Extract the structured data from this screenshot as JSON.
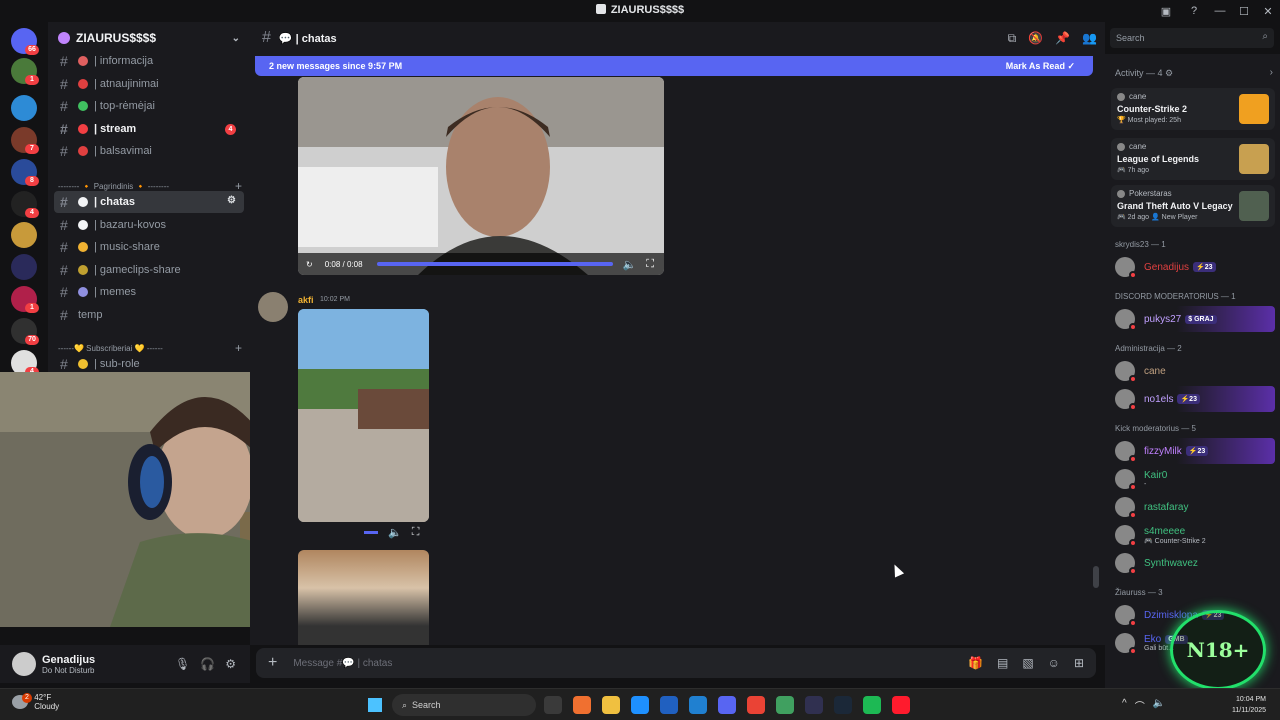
{
  "window": {
    "title": "ZIAURUS$$$$"
  },
  "servers": [
    {
      "color": "#5865f2",
      "badge": "66"
    },
    {
      "color": "#4a7a3a",
      "badge": "1"
    },
    {
      "color": "#2d8bd6",
      "badge": ""
    },
    {
      "color": "#7a3a2a",
      "badge": "7"
    },
    {
      "color": "#2a4b9a",
      "badge": "8"
    },
    {
      "color": "#222222",
      "badge": "4"
    },
    {
      "color": "#c89a3a",
      "badge": ""
    },
    {
      "color": "#2a2a5a",
      "badge": ""
    },
    {
      "color": "#b0204a",
      "badge": "1"
    },
    {
      "color": "#303030",
      "badge": "70"
    },
    {
      "color": "#e0e0e0",
      "badge": "4"
    }
  ],
  "guild": {
    "name": "ZIAURUS$$$$"
  },
  "channels": [
    {
      "label": "| informacija",
      "emoji_color": "#e06060",
      "state": "normal"
    },
    {
      "label": "| atnaujinimai",
      "emoji_color": "#e04040",
      "state": "normal"
    },
    {
      "label": "| top-rėmėjai",
      "emoji_color": "#40c060",
      "state": "normal"
    },
    {
      "label": "| stream",
      "emoji_color": "#f23f43",
      "state": "unread",
      "badge": "4"
    },
    {
      "label": "| balsavimai",
      "emoji_color": "#e04040",
      "state": "normal"
    }
  ],
  "category1": "-------- 🔸 Pagrindinis 🔸 --------",
  "channels2": [
    {
      "label": "| chatas",
      "emoji_color": "#f2f3f5",
      "state": "active"
    },
    {
      "label": "| bazaru-kovos",
      "emoji_color": "#f2f3f5",
      "state": "normal"
    },
    {
      "label": "| music-share",
      "emoji_color": "#f0b232",
      "state": "normal"
    },
    {
      "label": "| gameclips-share",
      "emoji_color": "#c0a030",
      "state": "normal"
    },
    {
      "label": "| memes",
      "emoji_color": "#9090e0",
      "state": "normal"
    },
    {
      "label": "temp",
      "emoji_color": "",
      "state": "normal"
    }
  ],
  "category2": "------💛 Subscriberiai 💛 ------",
  "channels3": [
    {
      "label": "| sub-role",
      "emoji_color": "#f0c030",
      "state": "normal"
    }
  ],
  "user": {
    "name": "Genadijus",
    "status": "Do Not Disturb"
  },
  "chat": {
    "channel_name": "| chatas",
    "new_messages": "2 new messages since 9:57 PM",
    "mark_read": "Mark As Read",
    "video_time": "0:08 / 0:08",
    "video_progress": 1.0,
    "author": "akfi",
    "time": "10:02 PM",
    "placeholder": "Message #💬 | chatas"
  },
  "search": {
    "placeholder": "Search"
  },
  "activity": {
    "header": "Activity — 4 ⚙",
    "cards": [
      {
        "user": "cane",
        "game": "Counter-Strike 2",
        "meta": "🏆 Most played: 25h",
        "color": "#f0a020"
      },
      {
        "user": "cane",
        "game": "League of Legends",
        "meta": "🎮 7h ago",
        "color": "#c8a050"
      },
      {
        "user": "Pokerstaras",
        "game": "Grand Theft Auto V Legacy",
        "meta": "🎮 2d ago  👤 New Player",
        "color": "#506050"
      }
    ]
  },
  "member_groups": [
    {
      "label": "skrydis23 — 1",
      "members": [
        {
          "name": "Genadijus",
          "color": "#e04040",
          "tag": "⚡23",
          "sub": ""
        }
      ]
    },
    {
      "label": "DISCORD MODERATORIUS — 1",
      "members": [
        {
          "name": "pukys27",
          "color": "#c0a0ff",
          "tag": "$ GRAJ",
          "sub": "",
          "banner": true
        }
      ]
    },
    {
      "label": "Administracija — 2",
      "members": [
        {
          "name": "cane",
          "color": "#c0a080",
          "tag": "",
          "sub": ""
        },
        {
          "name": "no1els",
          "color": "#c0a0ff",
          "tag": "⚡23",
          "sub": "",
          "banner": true
        }
      ]
    },
    {
      "label": "Kick moderatorius — 5",
      "members": [
        {
          "name": "fizzyMilk",
          "color": "#c080ff",
          "tag": "⚡23",
          "sub": "",
          "banner": true
        },
        {
          "name": "Kair0",
          "color": "#40c080",
          "tag": "",
          "sub": "-"
        },
        {
          "name": "rastafaray",
          "color": "#40c080",
          "tag": "",
          "sub": ""
        },
        {
          "name": "s4meeee",
          "color": "#40c080",
          "tag": "",
          "sub": "🎮 Counter-Strike 2"
        },
        {
          "name": "Synthwavez",
          "color": "#40c080",
          "tag": "",
          "sub": ""
        }
      ]
    },
    {
      "label": "Žiauruss — 3",
      "members": [
        {
          "name": "Dzimisklopa",
          "color": "#5865f2",
          "tag": "⚡23",
          "sub": ""
        },
        {
          "name": "Eko",
          "color": "#5865f2",
          "tag": "GMB",
          "sub": "Gali būt..."
        }
      ]
    }
  ],
  "overlay_badge": "N18+",
  "taskbar": {
    "temp": "42°F",
    "weather": "Cloudy",
    "weather_badge": "2",
    "search": "Search",
    "time": "10:04 PM",
    "date": "11/11/2025",
    "apps": [
      "#3a3a3a",
      "#f07030",
      "#f0c040",
      "#1e90ff",
      "#2060c0",
      "#2080d0",
      "#5865f2",
      "#ea4335",
      "#40a060",
      "#303050",
      "#1b2838",
      "#1db954",
      "#ff1b2d"
    ]
  }
}
